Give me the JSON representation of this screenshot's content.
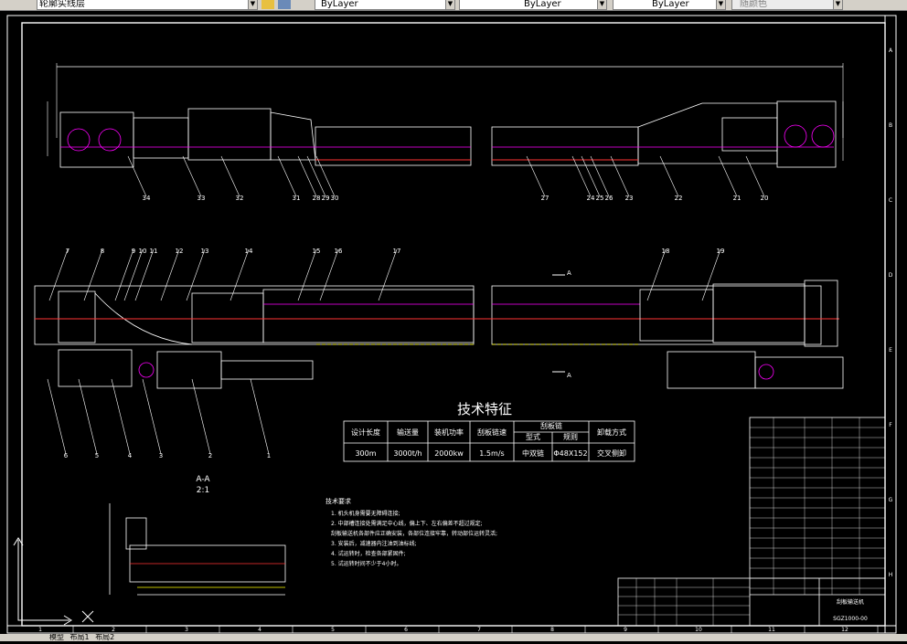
{
  "toolbar": {
    "layer_value": "轮廓实线层",
    "color_value": "ByLayer",
    "linetype_value": "ByLayer",
    "lineweight_value": "ByLayer",
    "plotstyle_value": "随颜色"
  },
  "status_tabs": [
    "模型",
    "布局1",
    "布局2"
  ],
  "drawing": {
    "tech_title": "技术特征",
    "spec_table": {
      "headers": [
        "设计长度",
        "输送量",
        "装机功率",
        "刮板链速",
        "刮板链",
        "卸载方式"
      ],
      "chain_sub": [
        "型式",
        "规则"
      ],
      "values": [
        "300m",
        "3000t/h",
        "2000kw",
        "1.5m/s",
        "中双链",
        "Φ48X152",
        "交叉侧卸"
      ]
    },
    "section_title": "A-A",
    "section_scale": "2:1",
    "tech_req_title": "技术要求",
    "tech_req_lines": [
      "1. 机头机身需要无障碍连接;",
      "2. 中部槽连接处需满足中心线，偏上下、左右偏差不超过规定;",
      "刮板输送机各部件应正确安装，各部位连接牢靠，转动部位运转灵活;",
      "3. 安装后，减速器内注油到油标线;",
      "4. 试运转时，检查各部紧固件;",
      "5. 试运转时间不少于4小时。"
    ],
    "balloons_top": [
      "34",
      "33",
      "32",
      "31",
      "28",
      "29",
      "30",
      "27",
      "24",
      "25",
      "26",
      "23",
      "22",
      "21",
      "20"
    ],
    "balloons_mid": [
      "7",
      "8",
      "9",
      "10",
      "11",
      "12",
      "13",
      "14",
      "15",
      "16",
      "17",
      "18",
      "19"
    ],
    "balloons_bot": [
      "6",
      "5",
      "4",
      "3",
      "2",
      "1"
    ],
    "border_cols": [
      "1",
      "2",
      "3",
      "4",
      "5",
      "6",
      "7",
      "8",
      "9",
      "10",
      "11",
      "12"
    ],
    "border_rows": [
      "A",
      "B",
      "C",
      "D",
      "E",
      "F",
      "G",
      "H"
    ],
    "section_mark": "A",
    "title_block_label": "刮板输送机",
    "title_block_code": "SGZ1000-00"
  }
}
